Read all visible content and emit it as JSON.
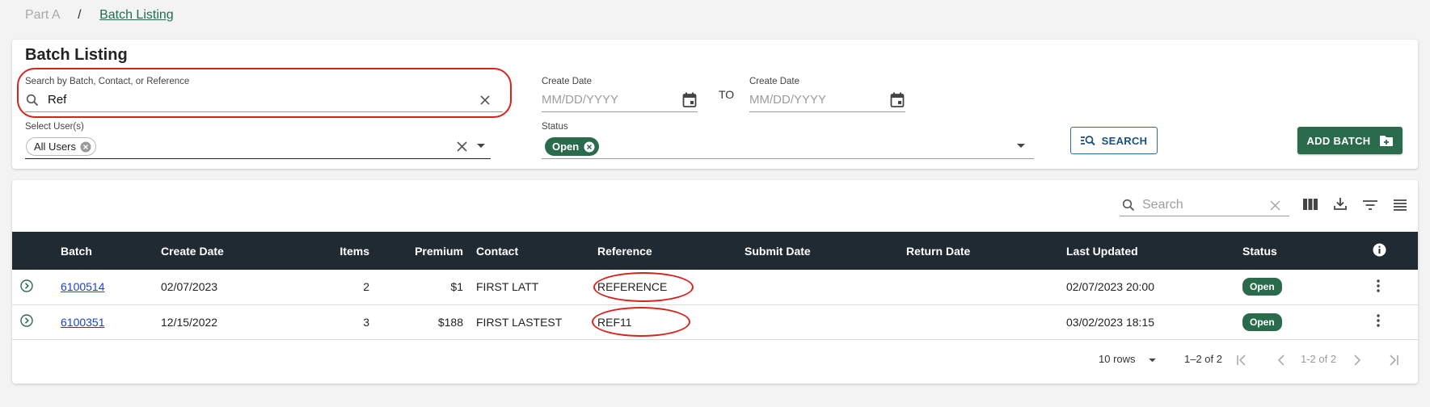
{
  "breadcrumb": {
    "parent": "Part A",
    "separator": "/",
    "current": "Batch Listing"
  },
  "filters": {
    "title": "Batch Listing",
    "search_label": "Search by Batch, Contact, or Reference",
    "search_value": "Ref",
    "create_date_from_label": "Create Date",
    "create_date_from_placeholder": "MM/DD/YYYY",
    "to_label": "TO",
    "create_date_to_label": "Create Date",
    "create_date_to_placeholder": "MM/DD/YYYY",
    "users_label": "Select User(s)",
    "users_chip": "All Users",
    "status_label": "Status",
    "status_chip": "Open",
    "search_button": "SEARCH",
    "add_batch_button": "ADD BATCH"
  },
  "table": {
    "search_placeholder": "Search",
    "columns": [
      "Batch",
      "Create Date",
      "Items",
      "Premium",
      "Contact",
      "Reference",
      "Submit Date",
      "Return Date",
      "Last Updated",
      "Status"
    ],
    "rows": [
      {
        "batch": "6100514",
        "create_date": "02/07/2023",
        "items": "2",
        "premium": "$1",
        "contact": "FIRST LATT",
        "reference": "REFERENCE",
        "submit_date": "",
        "return_date": "",
        "last_updated": "02/07/2023 20:00",
        "status": "Open"
      },
      {
        "batch": "6100351",
        "create_date": "12/15/2022",
        "items": "3",
        "premium": "$188",
        "contact": "FIRST LASTEST",
        "reference": "REF11",
        "submit_date": "",
        "return_date": "",
        "last_updated": "03/02/2023 18:15",
        "status": "Open"
      }
    ]
  },
  "pagination": {
    "rows_per_page": "10 rows",
    "range": "1–2 of 2",
    "range_nav": "1-2 of 2"
  },
  "colors": {
    "brand_green": "#2a6b4b",
    "header_dark": "#202a33",
    "link_blue": "#1a3fd6",
    "highlight_red": "#d9231c"
  },
  "icons": [
    "search-icon",
    "clear-icon",
    "calendar-icon",
    "chevron-down-icon",
    "cancel-chip-icon",
    "zoom-search-icon",
    "folder-add-icon",
    "columns-icon",
    "download-icon",
    "filter-icon",
    "density-icon",
    "info-icon",
    "expand-row-icon",
    "more-vert-icon",
    "first-page-icon",
    "prev-page-icon",
    "next-page-icon",
    "last-page-icon"
  ]
}
